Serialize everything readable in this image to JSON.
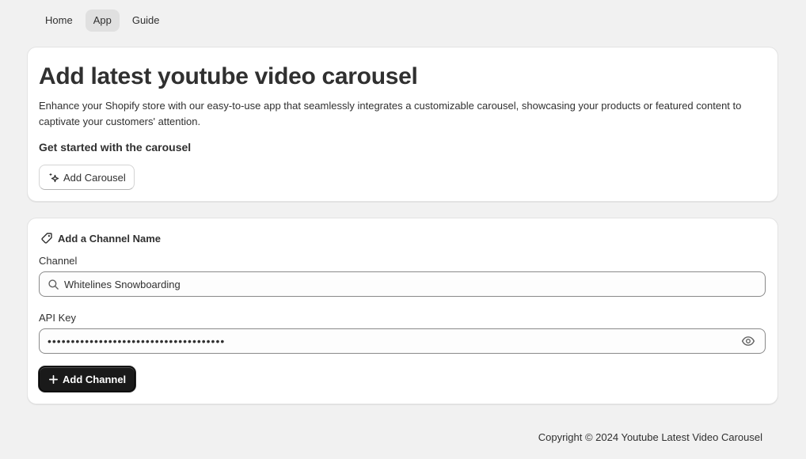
{
  "nav": {
    "tabs": [
      {
        "label": "Home",
        "active": false
      },
      {
        "label": "App",
        "active": true
      },
      {
        "label": "Guide",
        "active": false
      }
    ]
  },
  "intro_card": {
    "title": "Add latest youtube video carousel",
    "description": "Enhance your Shopify store with our easy-to-use app that seamlessly integrates a customizable carousel, showcasing your products or featured content to captivate your customers' attention.",
    "subheading": "Get started with the carousel",
    "add_carousel_label": "Add Carousel",
    "add_carousel_icon": "sparkle-icon"
  },
  "channel_card": {
    "heading": "Add a Channel Name",
    "heading_icon": "tag-icon",
    "channel_label": "Channel",
    "channel_value": "Whitelines Snowboarding",
    "channel_icon": "search-icon",
    "api_label": "API Key",
    "api_value": "••••••••••••••••••••••••••••••••••••••",
    "api_toggle_icon": "eye-icon",
    "add_channel_label": "Add Channel",
    "add_channel_icon": "plus-icon"
  },
  "footer": {
    "copyright": "Copyright © 2024 Youtube Latest Video Carousel"
  },
  "colors": {
    "background": "#f1f1f1",
    "card": "#ffffff",
    "primary_button": "#1a1a1a",
    "active_tab": "#e0e0e0"
  }
}
